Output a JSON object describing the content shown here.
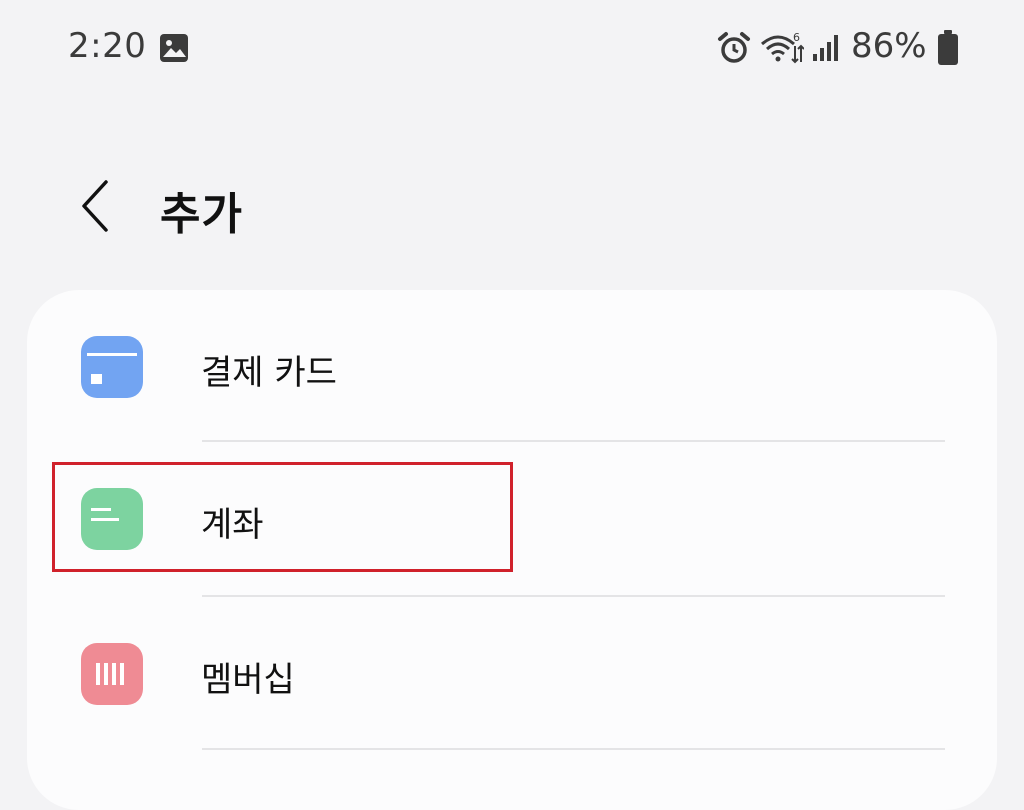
{
  "status_bar": {
    "time": "2:20",
    "battery_percent": "86%",
    "network_label": "6"
  },
  "header": {
    "title": "추가"
  },
  "list": {
    "items": [
      {
        "label": "결제 카드",
        "icon": "payment-card-icon",
        "color": "#72a4f2"
      },
      {
        "label": "계좌",
        "icon": "bank-account-icon",
        "color": "#7dd3a0"
      },
      {
        "label": "멤버십",
        "icon": "membership-barcode-icon",
        "color": "#ef8b94"
      }
    ]
  },
  "colors": {
    "background": "#f3f3f5",
    "card": "#fcfcfd",
    "highlight": "#d0212b"
  }
}
